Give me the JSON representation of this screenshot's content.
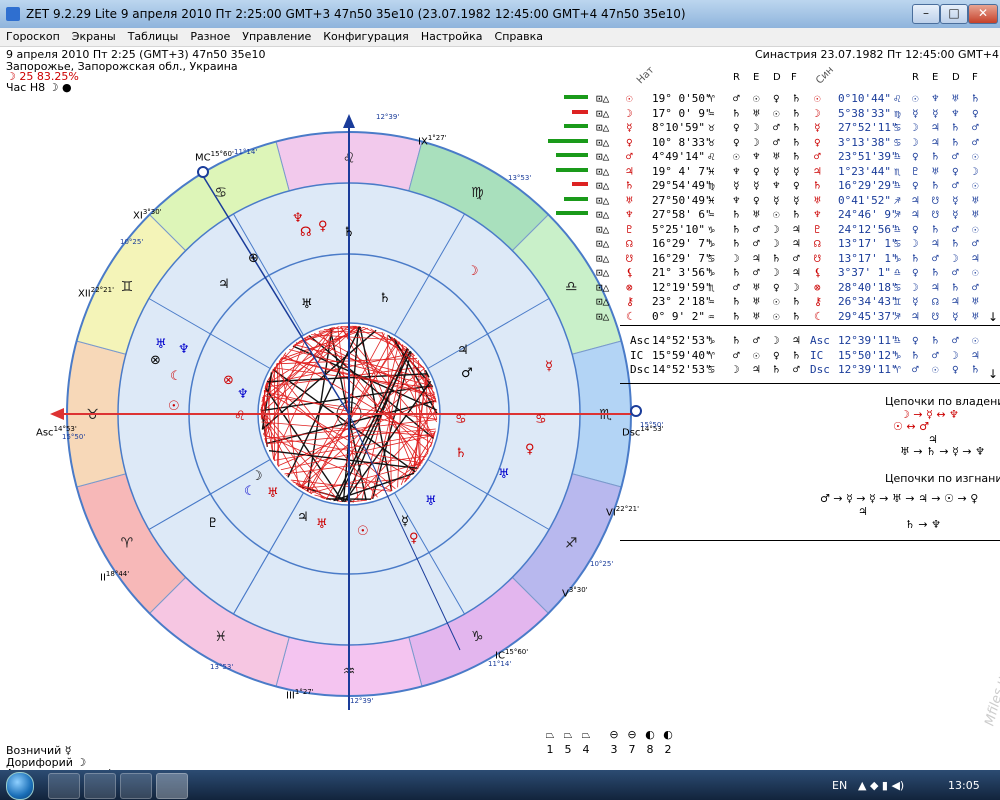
{
  "window": {
    "title": "ZET 9.2.29 Lite     9 апреля 2010  Пт   2:25:00 GMT+3 47n50  35e10  (23.07.1982  12:45:00 GMT+4 47n50  35e10)",
    "minimize": "–",
    "maximize": "□",
    "close": "✕"
  },
  "menu": [
    "Гороскоп",
    "Экраны",
    "Таблицы",
    "Разное",
    "Управление",
    "Конфигурация",
    "Настройка",
    "Справка"
  ],
  "header_left": {
    "line1": "9 апреля 2010   Пт   2:25 (GMT+3) 47n50  35e10",
    "line2": "Запорожье, Запорожская обл., Украина",
    "line3": "☽   25 83.25%",
    "line4": "Час H8 ☽ ●"
  },
  "header_right": "Синастрия 23.07.1982  Пт 12:45:00 GMT+4",
  "chart": {
    "zodiac_signs": [
      {
        "glyph": "♌",
        "color": "#f2c9ec"
      },
      {
        "glyph": "♍",
        "color": "#a9e0bd"
      },
      {
        "glyph": "♎",
        "color": "#c9f0c9"
      },
      {
        "glyph": "♏",
        "color": "#b3d4f5"
      },
      {
        "glyph": "♐",
        "color": "#b8b8ee"
      },
      {
        "glyph": "♑",
        "color": "#e3b6ee"
      },
      {
        "glyph": "♒",
        "color": "#f4c4f0"
      },
      {
        "glyph": "♓",
        "color": "#f6c6e2"
      },
      {
        "glyph": "♈",
        "color": "#f7b8b8"
      },
      {
        "glyph": "♉",
        "color": "#f7d8b8"
      },
      {
        "glyph": "♊",
        "color": "#f4f4b8"
      },
      {
        "glyph": "♋",
        "color": "#ddf5b8"
      }
    ],
    "labels": {
      "mc": "MC",
      "mc_deg": "15°60'",
      "mc_min": "11°14'",
      "ic": "IC",
      "ic_deg": "15°60'",
      "ic_min": "11°14'",
      "asc": "Asc",
      "asc_deg": "14°53'",
      "asc_min": "15°50'",
      "dsc": "Dsc",
      "dsc_deg": "14°53'",
      "dsc_min": "15°50'",
      "cusp_ix": "IX",
      "cusp_ix_deg": "1°27'",
      "cusp_iii": "III",
      "cusp_iii_deg": "1°27'",
      "cusp_xi": "XI",
      "cusp_xi_deg": "3°30'",
      "cusp_xii": "XII",
      "cusp_xii_deg": "22°21'",
      "cusp_vi": "VI",
      "cusp_vi_deg": "22°21'",
      "cusp_v": "V",
      "cusp_v_deg": "3°30'",
      "cusp_ii": "II",
      "cusp_ii_deg": "18°44'",
      "top_deg": "12°39'",
      "bottom_deg": "12°39'",
      "deg_1053": "10°25'",
      "deg_1353": "13°53'",
      "deg_1353b": "13°53'",
      "deg_1025b": "10°25'",
      "deg_1353c": "13°53'"
    }
  },
  "table": {
    "col_headers": {
      "nat": "Нат",
      "r": "R",
      "e": "E",
      "d": "D",
      "f": "F",
      "syn": "Син",
      "r2": "R",
      "e2": "E",
      "d2": "D",
      "f2": "F"
    },
    "rows": [
      {
        "bar": 3,
        "pl": "☉",
        "pos": "19° 0'50\"",
        "sg": "♈",
        "r": "♂",
        "e": "☉",
        "d": "♀",
        "f": "♄",
        "spl": "☉",
        "spos": "0°10'44\"",
        "ssg": "♌",
        "sr": "☉",
        "se": "♆",
        "sd": "♅",
        "sf": "♄"
      },
      {
        "bar": 2,
        "pl": "☽",
        "pos": "17° 0' 9\"",
        "sg": "♒",
        "r": "♄",
        "e": "♅",
        "d": "☉",
        "f": "♄",
        "spl": "☽",
        "spos": "5°38'33\"",
        "ssg": "♍",
        "sr": "☿",
        "se": "☿",
        "sd": "♆",
        "sf": "♀"
      },
      {
        "bar": 3,
        "pl": "☿",
        "pos": "8°10'59\"",
        "sg": "♉",
        "r": "♀",
        "e": "☽",
        "d": "♂",
        "f": "♄",
        "spl": "☿",
        "spos": "27°52'11\"",
        "ssg": "♋",
        "sr": "☽",
        "se": "♃",
        "sd": "♄",
        "sf": "♂"
      },
      {
        "bar": 5,
        "pl": "♀",
        "pos": "10° 8'33\"",
        "sg": "♉",
        "r": "♀",
        "e": "☽",
        "d": "♂",
        "f": "♄",
        "spl": "♀",
        "spos": "3°13'38\"",
        "ssg": "♋",
        "sr": "☽",
        "se": "♃",
        "sd": "♄",
        "sf": "♂"
      },
      {
        "bar": 4,
        "pl": "♂",
        "pos": "4°49'14\"",
        "sg": "♌",
        "r": "☉",
        "e": "♆",
        "d": "♅",
        "f": "♄",
        "spl": "♂",
        "spos": "23°51'39\"",
        "ssg": "♎",
        "sr": "♀",
        "se": "♄",
        "sd": "♂",
        "sf": "☉"
      },
      {
        "bar": 4,
        "pl": "♃",
        "pos": "19° 4' 7\"",
        "sg": "♓",
        "r": "♆",
        "e": "♀",
        "d": "☿",
        "f": "☿",
        "spl": "♃",
        "spos": "1°23'44\"",
        "ssg": "♏",
        "sr": "♇",
        "se": "♅",
        "sd": "♀",
        "sf": "☽"
      },
      {
        "bar": 2,
        "pl": "♄",
        "pos": "29°54'49\"",
        "sg": "♍",
        "r": "☿",
        "e": "☿",
        "d": "♆",
        "f": "♀",
        "spl": "♄",
        "spos": "16°29'29\"",
        "ssg": "♎",
        "sr": "♀",
        "se": "♄",
        "sd": "♂",
        "sf": "☉"
      },
      {
        "bar": 3,
        "pl": "♅",
        "pos": "27°50'49\"",
        "sg": "♓",
        "r": "♆",
        "e": "♀",
        "d": "☿",
        "f": "☿",
        "spl": "♅",
        "spos": "0°41'52\"",
        "ssg": "♐",
        "sr": "♃",
        "se": "☋",
        "sd": "☿",
        "sf": "♅"
      },
      {
        "bar": 4,
        "pl": "♆",
        "pos": "27°58' 6\"",
        "sg": "♒",
        "r": "♄",
        "e": "♅",
        "d": "☉",
        "f": "♄",
        "spl": "♆",
        "spos": "24°46' 9\"",
        "ssg": "♐",
        "sr": "♃",
        "se": "☋",
        "sd": "☿",
        "sf": "♅"
      },
      {
        "bar": 0,
        "pl": "♇",
        "pos": "5°25'10\"",
        "sg": "♑",
        "r": "♄",
        "e": "♂",
        "d": "☽",
        "f": "♃",
        "spl": "♇",
        "spos": "24°12'56\"",
        "ssg": "♎",
        "sr": "♀",
        "se": "♄",
        "sd": "♂",
        "sf": "☉"
      },
      {
        "bar": 0,
        "pl": "☊",
        "pos": "16°29' 7\"",
        "sg": "♑",
        "r": "♄",
        "e": "♂",
        "d": "☽",
        "f": "♃",
        "spl": "☊",
        "spos": "13°17' 1\"",
        "ssg": "♋",
        "sr": "☽",
        "se": "♃",
        "sd": "♄",
        "sf": "♂"
      },
      {
        "bar": 0,
        "pl": "☋",
        "pos": "16°29' 7\"",
        "sg": "♋",
        "r": "☽",
        "e": "♃",
        "d": "♄",
        "f": "♂",
        "spl": "☋",
        "spos": "13°17' 1\"",
        "ssg": "♑",
        "sr": "♄",
        "se": "♂",
        "sd": "☽",
        "sf": "♃"
      },
      {
        "bar": 0,
        "pl": "⚸",
        "pos": "21° 3'56\"",
        "sg": "♑",
        "r": "♄",
        "e": "♂",
        "d": "☽",
        "f": "♃",
        "spl": "⚸",
        "spos": "3°37' 1\"",
        "ssg": "♎",
        "sr": "♀",
        "se": "♄",
        "sd": "♂",
        "sf": "☉"
      },
      {
        "bar": 0,
        "pl": "⊗",
        "pos": "12°19'59\"",
        "sg": "♏",
        "r": "♂",
        "e": "♅",
        "d": "♀",
        "f": "☽",
        "spl": "⊗",
        "spos": "28°40'18\"",
        "ssg": "♋",
        "sr": "☽",
        "se": "♃",
        "sd": "♄",
        "sf": "♂"
      },
      {
        "bar": 0,
        "pl": "⚷",
        "pos": "23° 2'18\"",
        "sg": "♒",
        "r": "♄",
        "e": "♅",
        "d": "☉",
        "f": "♄",
        "spl": "⚷",
        "spos": "26°34'43\"",
        "ssg": "♊",
        "sr": "☿",
        "se": "☊",
        "sd": "♃",
        "sf": "♅"
      },
      {
        "bar": 0,
        "pl": "☾",
        "pos": "0° 9' 2\"",
        "sg": "♒",
        "r": "♄",
        "e": "♅",
        "d": "☉",
        "f": "♄",
        "spl": "☾",
        "spos": "29°45'37\"",
        "ssg": "♐",
        "sr": "♃",
        "se": "☋",
        "sd": "☿",
        "sf": "♅"
      }
    ],
    "angle_rows": [
      {
        "pl": "Asc",
        "pos": "14°52'53\"",
        "sg": "♑",
        "r": "♄",
        "e": "♂",
        "d": "☽",
        "f": "♃",
        "spl": "Asc",
        "spos": "12°39'11\"",
        "ssg": "♎",
        "sr": "♀",
        "se": "♄",
        "sd": "♂",
        "sf": "☉"
      },
      {
        "pl": "IC",
        "pos": "15°59'40\"",
        "sg": "♈",
        "r": "♂",
        "e": "☉",
        "d": "♀",
        "f": "♄",
        "spl": "IC",
        "spos": "15°50'12\"",
        "ssg": "♑",
        "sr": "♄",
        "se": "♂",
        "sd": "☽",
        "sf": "♃"
      },
      {
        "pl": "Dsc",
        "pos": "14°52'53\"",
        "sg": "♋",
        "r": "☽",
        "e": "♃",
        "d": "♄",
        "f": "♂",
        "spl": "Dsc",
        "spos": "12°39'11\"",
        "ssg": "♈",
        "sr": "♂",
        "se": "☉",
        "sd": "♀",
        "sf": "♄"
      }
    ]
  },
  "chains": {
    "ownership_title": "Цепочки по владению",
    "ownership_line1": "☽ → ☿ ↔ ♆",
    "ownership_line2": "☉ ↔ ♂",
    "ownership_line3": "♃",
    "ownership_line4": "♅ → ♄ → ☿ → ♆",
    "exile_title": "Цепочки по изгнанию",
    "exile_line1": "♂ → ☿ → ☿ → ♅ → ♃ → ☉ → ♀",
    "exile_line2": "♃",
    "exile_line3": "♄ → ♆"
  },
  "bottom_left": {
    "line1": "Возничий  ☿",
    "line2": "Дорифорий  ☽",
    "line3": "Ал-мутен карты  ♃"
  },
  "bottom_symbols": {
    "row1": [
      "1",
      "5",
      "4",
      "3",
      "7",
      "8",
      "2"
    ]
  },
  "taskbar": {
    "lang": "EN",
    "time": "13:05"
  },
  "watermark": "Mfiles.ua"
}
